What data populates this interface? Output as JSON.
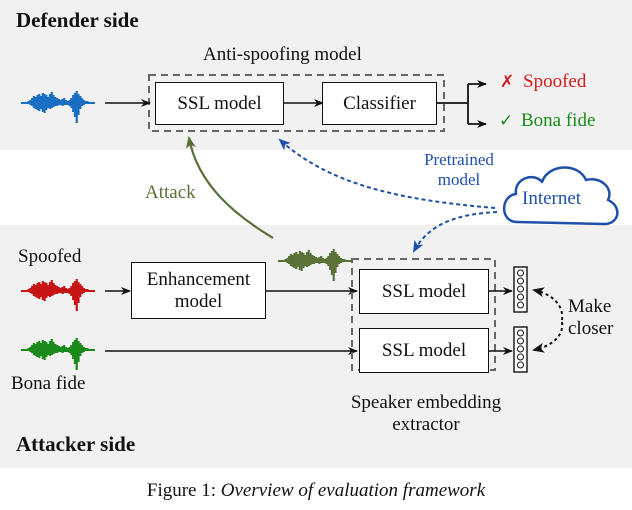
{
  "defender": {
    "title": "Defender side",
    "model_group_label": "Anti-spoofing model",
    "ssl_label": "SSL model",
    "classifier_label": "Classifier",
    "outputs": [
      {
        "label": "Spoofed",
        "icon": "cross-icon",
        "symbol": "✗",
        "color": "#d7191c"
      },
      {
        "label": "Bona fide",
        "icon": "check-icon",
        "symbol": "✓",
        "color": "#1a8a1a"
      }
    ],
    "input_wave_color": "#1a6fc4"
  },
  "middle": {
    "attack_label": "Attack",
    "attack_color": "#5a7239",
    "pretrained_label_line1": "Pretrained",
    "pretrained_label_line2": "model",
    "pretrained_color": "#1f4fa8",
    "internet_label": "Internet"
  },
  "attacker": {
    "title": "Attacker side",
    "spoofed_label": "Spoofed",
    "bonafide_label": "Bona fide",
    "spoofed_wave_color": "#c81414",
    "bonafide_wave_color": "#1a8a1a",
    "enhanced_wave_color": "#5a7239",
    "enhancement_line1": "Enhancement",
    "enhancement_line2": "model",
    "ssl_top_label": "SSL model",
    "ssl_bottom_label": "SSL model",
    "extractor_line1": "Speaker embedding",
    "extractor_line2": "extractor",
    "make_closer_line1": "Make",
    "make_closer_line2": "closer"
  },
  "caption": {
    "prefix": "Figure 1: ",
    "text": "Overview of evaluation framework"
  }
}
